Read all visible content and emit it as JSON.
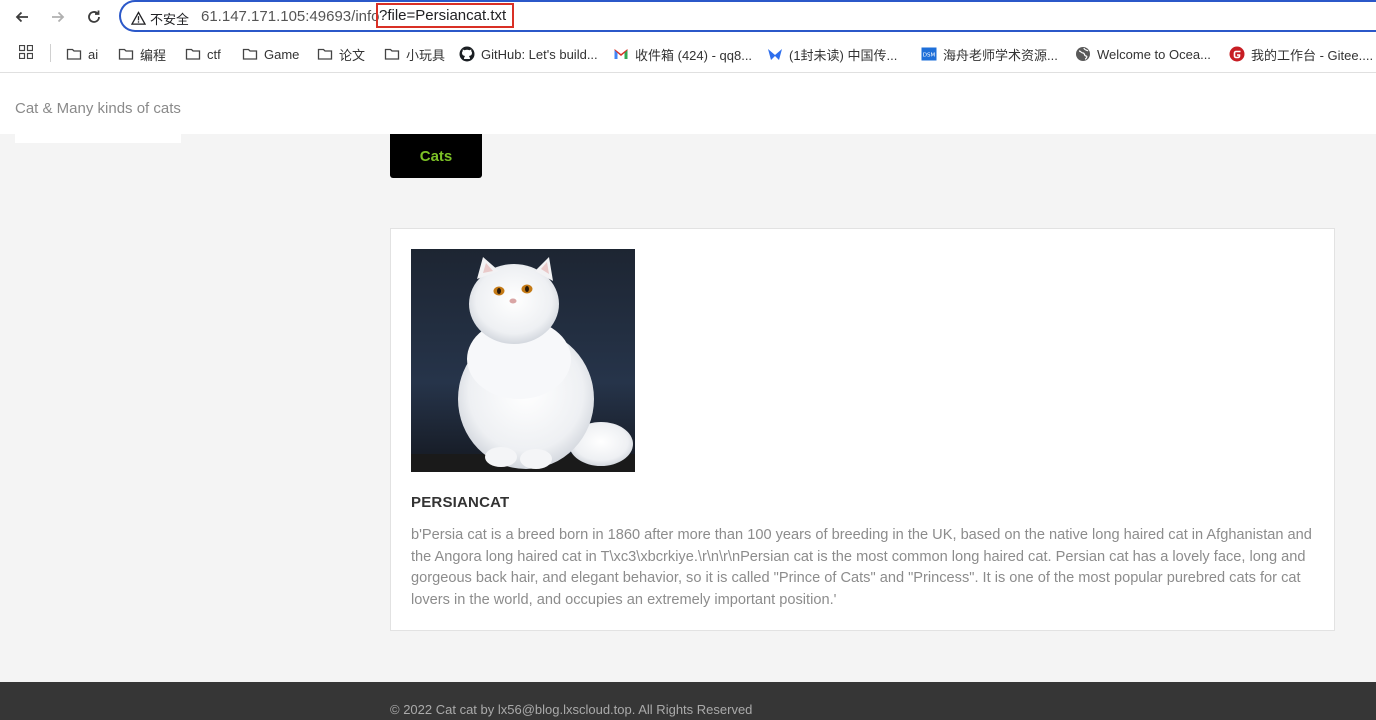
{
  "browser": {
    "security_label": "不安全",
    "url_base": "61.147.171.105:49693/info",
    "url_query": "?file=Persiancat.txt"
  },
  "bookmarks": [
    {
      "label": "ai",
      "icon": "folder-icon"
    },
    {
      "label": "编程",
      "icon": "folder-icon"
    },
    {
      "label": "ctf",
      "icon": "folder-icon"
    },
    {
      "label": "Game",
      "icon": "folder-icon"
    },
    {
      "label": "论文",
      "icon": "folder-icon"
    },
    {
      "label": "小玩具",
      "icon": "folder-icon"
    },
    {
      "label": "GitHub: Let's build...",
      "icon": "github-icon"
    },
    {
      "label": "收件箱 (424) - qq8...",
      "icon": "gmail-icon"
    },
    {
      "label": "(1封未读) 中国传...",
      "icon": "mail-icon"
    },
    {
      "label": "海舟老师学术资源...",
      "icon": "dsm-icon"
    },
    {
      "label": "Welcome to Ocea...",
      "icon": "globe-icon"
    },
    {
      "label": "我的工作台 - Gitee....",
      "icon": "gitee-icon"
    }
  ],
  "site": {
    "brand": "Cat & Many kinds of cats",
    "nav_tab": "Cats"
  },
  "article": {
    "title": "PERSIANCAT",
    "description": "b'Persia cat is a breed born in 1860 after more than 100 years of breeding in the UK, based on the native long haired cat in Afghanistan and the Angora long haired cat in T\\xc3\\xbcrkiye.\\r\\n\\r\\nPersian cat is the most common long haired cat. Persian cat has a lovely face, long and gorgeous back hair, and elegant behavior, so it is called \"Prince of Cats\" and \"Princess\". It is one of the most popular purebred cats for cat lovers in the world, and occupies an extremely important position.'"
  },
  "footer": {
    "text": "© 2022 Cat cat by lx56@blog.lxscloud.top. All Rights Reserved"
  },
  "colors": {
    "accent_green": "#7cc126",
    "omnibox_border": "#2b58c9",
    "highlight_red": "#d93025",
    "footer_bg": "#363636"
  }
}
